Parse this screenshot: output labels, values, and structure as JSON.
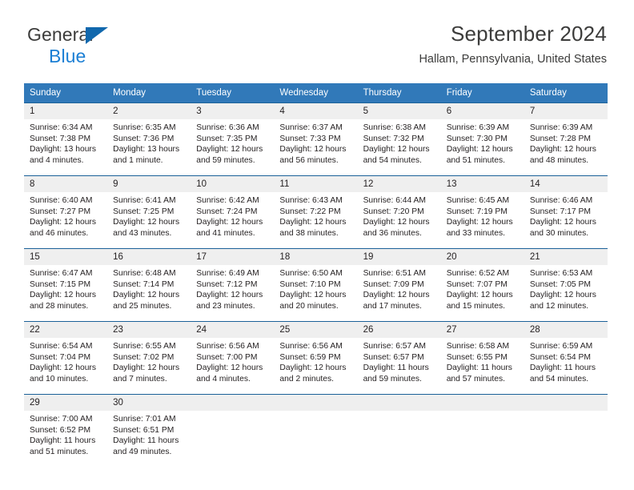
{
  "brand": {
    "name_top": "General",
    "name_bottom": "Blue",
    "triangle_color": "#1168ad",
    "blue_text_color": "#1b7fd4"
  },
  "header": {
    "title": "September 2024",
    "subtitle": "Hallam, Pennsylvania, United States"
  },
  "theme": {
    "header_bg": "#3179b9",
    "header_text": "#ffffff",
    "daynum_bg": "#efefef",
    "row_divider": "#1b6198",
    "body_text": "#231f20"
  },
  "weekday_headers": [
    "Sunday",
    "Monday",
    "Tuesday",
    "Wednesday",
    "Thursday",
    "Friday",
    "Saturday"
  ],
  "weeks": [
    [
      {
        "day": "1",
        "sunrise": "Sunrise: 6:34 AM",
        "sunset": "Sunset: 7:38 PM",
        "daylight1": "Daylight: 13 hours",
        "daylight2": "and 4 minutes."
      },
      {
        "day": "2",
        "sunrise": "Sunrise: 6:35 AM",
        "sunset": "Sunset: 7:36 PM",
        "daylight1": "Daylight: 13 hours",
        "daylight2": "and 1 minute."
      },
      {
        "day": "3",
        "sunrise": "Sunrise: 6:36 AM",
        "sunset": "Sunset: 7:35 PM",
        "daylight1": "Daylight: 12 hours",
        "daylight2": "and 59 minutes."
      },
      {
        "day": "4",
        "sunrise": "Sunrise: 6:37 AM",
        "sunset": "Sunset: 7:33 PM",
        "daylight1": "Daylight: 12 hours",
        "daylight2": "and 56 minutes."
      },
      {
        "day": "5",
        "sunrise": "Sunrise: 6:38 AM",
        "sunset": "Sunset: 7:32 PM",
        "daylight1": "Daylight: 12 hours",
        "daylight2": "and 54 minutes."
      },
      {
        "day": "6",
        "sunrise": "Sunrise: 6:39 AM",
        "sunset": "Sunset: 7:30 PM",
        "daylight1": "Daylight: 12 hours",
        "daylight2": "and 51 minutes."
      },
      {
        "day": "7",
        "sunrise": "Sunrise: 6:39 AM",
        "sunset": "Sunset: 7:28 PM",
        "daylight1": "Daylight: 12 hours",
        "daylight2": "and 48 minutes."
      }
    ],
    [
      {
        "day": "8",
        "sunrise": "Sunrise: 6:40 AM",
        "sunset": "Sunset: 7:27 PM",
        "daylight1": "Daylight: 12 hours",
        "daylight2": "and 46 minutes."
      },
      {
        "day": "9",
        "sunrise": "Sunrise: 6:41 AM",
        "sunset": "Sunset: 7:25 PM",
        "daylight1": "Daylight: 12 hours",
        "daylight2": "and 43 minutes."
      },
      {
        "day": "10",
        "sunrise": "Sunrise: 6:42 AM",
        "sunset": "Sunset: 7:24 PM",
        "daylight1": "Daylight: 12 hours",
        "daylight2": "and 41 minutes."
      },
      {
        "day": "11",
        "sunrise": "Sunrise: 6:43 AM",
        "sunset": "Sunset: 7:22 PM",
        "daylight1": "Daylight: 12 hours",
        "daylight2": "and 38 minutes."
      },
      {
        "day": "12",
        "sunrise": "Sunrise: 6:44 AM",
        "sunset": "Sunset: 7:20 PM",
        "daylight1": "Daylight: 12 hours",
        "daylight2": "and 36 minutes."
      },
      {
        "day": "13",
        "sunrise": "Sunrise: 6:45 AM",
        "sunset": "Sunset: 7:19 PM",
        "daylight1": "Daylight: 12 hours",
        "daylight2": "and 33 minutes."
      },
      {
        "day": "14",
        "sunrise": "Sunrise: 6:46 AM",
        "sunset": "Sunset: 7:17 PM",
        "daylight1": "Daylight: 12 hours",
        "daylight2": "and 30 minutes."
      }
    ],
    [
      {
        "day": "15",
        "sunrise": "Sunrise: 6:47 AM",
        "sunset": "Sunset: 7:15 PM",
        "daylight1": "Daylight: 12 hours",
        "daylight2": "and 28 minutes."
      },
      {
        "day": "16",
        "sunrise": "Sunrise: 6:48 AM",
        "sunset": "Sunset: 7:14 PM",
        "daylight1": "Daylight: 12 hours",
        "daylight2": "and 25 minutes."
      },
      {
        "day": "17",
        "sunrise": "Sunrise: 6:49 AM",
        "sunset": "Sunset: 7:12 PM",
        "daylight1": "Daylight: 12 hours",
        "daylight2": "and 23 minutes."
      },
      {
        "day": "18",
        "sunrise": "Sunrise: 6:50 AM",
        "sunset": "Sunset: 7:10 PM",
        "daylight1": "Daylight: 12 hours",
        "daylight2": "and 20 minutes."
      },
      {
        "day": "19",
        "sunrise": "Sunrise: 6:51 AM",
        "sunset": "Sunset: 7:09 PM",
        "daylight1": "Daylight: 12 hours",
        "daylight2": "and 17 minutes."
      },
      {
        "day": "20",
        "sunrise": "Sunrise: 6:52 AM",
        "sunset": "Sunset: 7:07 PM",
        "daylight1": "Daylight: 12 hours",
        "daylight2": "and 15 minutes."
      },
      {
        "day": "21",
        "sunrise": "Sunrise: 6:53 AM",
        "sunset": "Sunset: 7:05 PM",
        "daylight1": "Daylight: 12 hours",
        "daylight2": "and 12 minutes."
      }
    ],
    [
      {
        "day": "22",
        "sunrise": "Sunrise: 6:54 AM",
        "sunset": "Sunset: 7:04 PM",
        "daylight1": "Daylight: 12 hours",
        "daylight2": "and 10 minutes."
      },
      {
        "day": "23",
        "sunrise": "Sunrise: 6:55 AM",
        "sunset": "Sunset: 7:02 PM",
        "daylight1": "Daylight: 12 hours",
        "daylight2": "and 7 minutes."
      },
      {
        "day": "24",
        "sunrise": "Sunrise: 6:56 AM",
        "sunset": "Sunset: 7:00 PM",
        "daylight1": "Daylight: 12 hours",
        "daylight2": "and 4 minutes."
      },
      {
        "day": "25",
        "sunrise": "Sunrise: 6:56 AM",
        "sunset": "Sunset: 6:59 PM",
        "daylight1": "Daylight: 12 hours",
        "daylight2": "and 2 minutes."
      },
      {
        "day": "26",
        "sunrise": "Sunrise: 6:57 AM",
        "sunset": "Sunset: 6:57 PM",
        "daylight1": "Daylight: 11 hours",
        "daylight2": "and 59 minutes."
      },
      {
        "day": "27",
        "sunrise": "Sunrise: 6:58 AM",
        "sunset": "Sunset: 6:55 PM",
        "daylight1": "Daylight: 11 hours",
        "daylight2": "and 57 minutes."
      },
      {
        "day": "28",
        "sunrise": "Sunrise: 6:59 AM",
        "sunset": "Sunset: 6:54 PM",
        "daylight1": "Daylight: 11 hours",
        "daylight2": "and 54 minutes."
      }
    ],
    [
      {
        "day": "29",
        "sunrise": "Sunrise: 7:00 AM",
        "sunset": "Sunset: 6:52 PM",
        "daylight1": "Daylight: 11 hours",
        "daylight2": "and 51 minutes."
      },
      {
        "day": "30",
        "sunrise": "Sunrise: 7:01 AM",
        "sunset": "Sunset: 6:51 PM",
        "daylight1": "Daylight: 11 hours",
        "daylight2": "and 49 minutes."
      },
      {
        "day": "",
        "sunrise": "",
        "sunset": "",
        "daylight1": "",
        "daylight2": ""
      },
      {
        "day": "",
        "sunrise": "",
        "sunset": "",
        "daylight1": "",
        "daylight2": ""
      },
      {
        "day": "",
        "sunrise": "",
        "sunset": "",
        "daylight1": "",
        "daylight2": ""
      },
      {
        "day": "",
        "sunrise": "",
        "sunset": "",
        "daylight1": "",
        "daylight2": ""
      },
      {
        "day": "",
        "sunrise": "",
        "sunset": "",
        "daylight1": "",
        "daylight2": ""
      }
    ]
  ]
}
